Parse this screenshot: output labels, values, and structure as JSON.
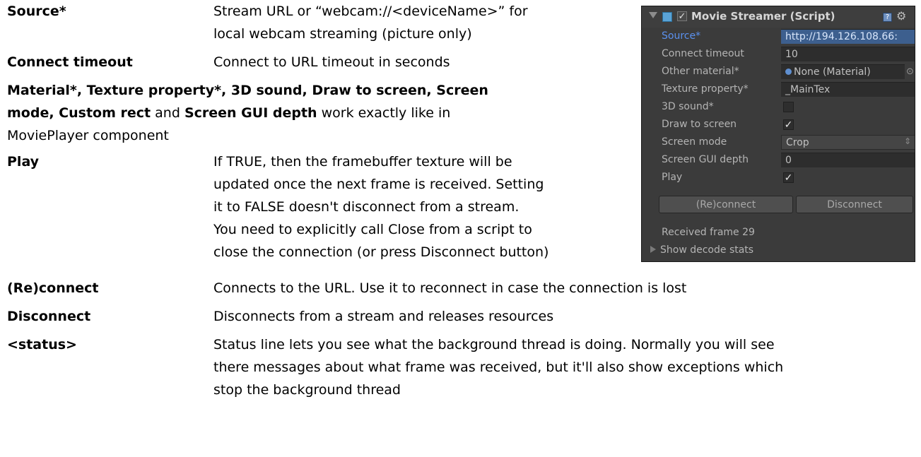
{
  "docs": {
    "source": {
      "term": "Source*",
      "desc": [
        "Stream URL or “webcam://<deviceName>” for",
        "local webcam streaming (picture only)"
      ]
    },
    "connect_timeout": {
      "term": "Connect timeout",
      "desc": "Connect to URL timeout in seconds"
    },
    "shared": {
      "bold1": "Material*, Texture property*, 3D sound, Draw to screen, Screen",
      "bold2": "mode, Custom rect",
      "and": " and ",
      "bold3": "Screen GUI depth",
      "rest": " work exactly like in",
      "line3": "MoviePlayer component"
    },
    "play": {
      "term": "Play",
      "desc": [
        "If TRUE, then the framebuffer texture will be",
        "updated once the next frame is received. Setting",
        "it to FALSE doesn't disconnect from a stream.",
        "You need to explicitly call Close from a script to",
        "close the connection (or press Disconnect button)"
      ]
    },
    "reconnect": {
      "term": "(Re)connect",
      "desc": "Connects to the URL. Use it to reconnect in case the connection is lost"
    },
    "disconnect": {
      "term": "Disconnect",
      "desc": "Disconnects from a stream and releases resources"
    },
    "status": {
      "term": "<status>",
      "desc": [
        "Status line lets you see what the background thread is doing. Normally you will see",
        "there messages about what frame was received, but it'll also show exceptions which",
        "stop the background thread"
      ]
    }
  },
  "inspector": {
    "title": "Movie Streamer (Script)",
    "fields": [
      {
        "label": "Source*",
        "value": "http://194.126.108.66:"
      },
      {
        "label": "Connect timeout",
        "value": "10"
      },
      {
        "label": "Other material*",
        "value": "None (Material)"
      },
      {
        "label": "Texture property*",
        "value": "_MainTex"
      },
      {
        "label": "3D sound*",
        "checked": false
      },
      {
        "label": "Draw to screen",
        "checked": true
      },
      {
        "label": "Screen mode",
        "value": "Crop"
      },
      {
        "label": "Screen GUI depth",
        "value": "0"
      },
      {
        "label": "Play",
        "checked": true
      }
    ],
    "reconnect_label": "(Re)connect",
    "disconnect_label": "Disconnect",
    "status_text": "Received frame 29",
    "decode_stats_label": "Show decode stats",
    "checkmark": "✓"
  },
  "colors": {
    "selection": "#3d5f8e",
    "selected_label": "#5b91ef",
    "panel_bg": "#3b3b3b"
  }
}
